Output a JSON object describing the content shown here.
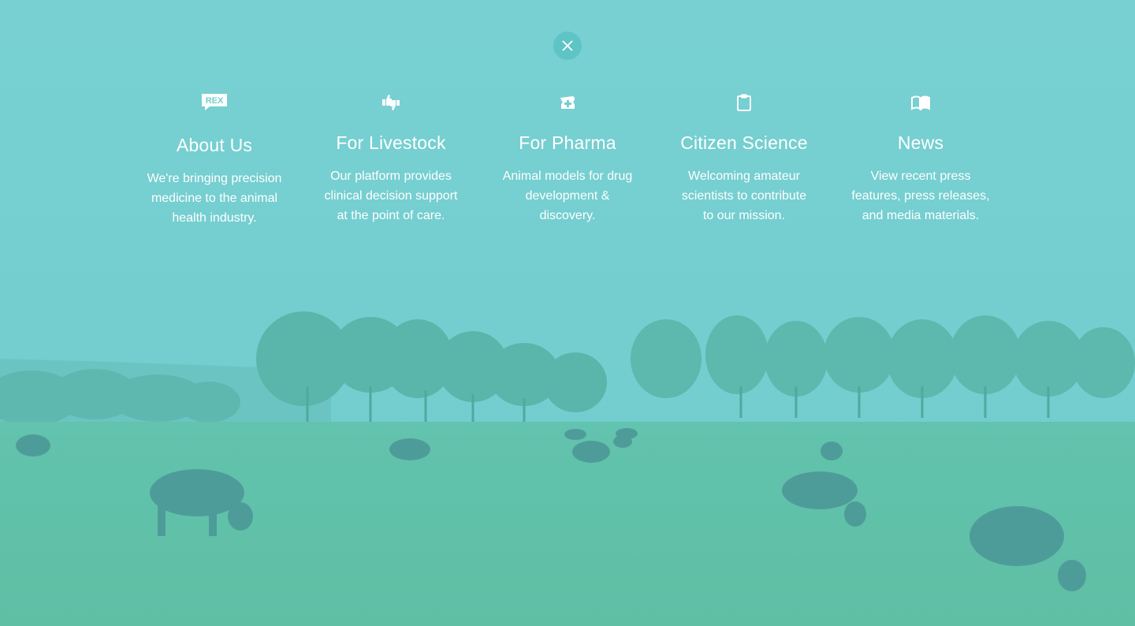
{
  "close_button": {
    "icon": "close-icon"
  },
  "menu": {
    "items": [
      {
        "icon": "rex-logo-icon",
        "logo_text": "REX",
        "title": "About Us",
        "description": "We're bringing precision\nmedicine to the animal\nhealth industry."
      },
      {
        "icon": "thumbs-icon",
        "title": "For Livestock",
        "description": "Our platform provides\nclinical decision support\nat the point of care."
      },
      {
        "icon": "medicine-box-icon",
        "title": "For Pharma",
        "description": "Animal models for drug\ndevelopment &\ndiscovery."
      },
      {
        "icon": "clipboard-icon",
        "title": "Citizen Science",
        "description": "Welcoming amateur\nscientists to contribute\nto our mission."
      },
      {
        "icon": "book-icon",
        "title": "News",
        "description": "View recent press\nfeatures, press releases,\nand media materials."
      }
    ]
  },
  "colors": {
    "overlay": "#74cfd0",
    "text": "#ffffff",
    "close_bg": "#5fc4c6"
  }
}
